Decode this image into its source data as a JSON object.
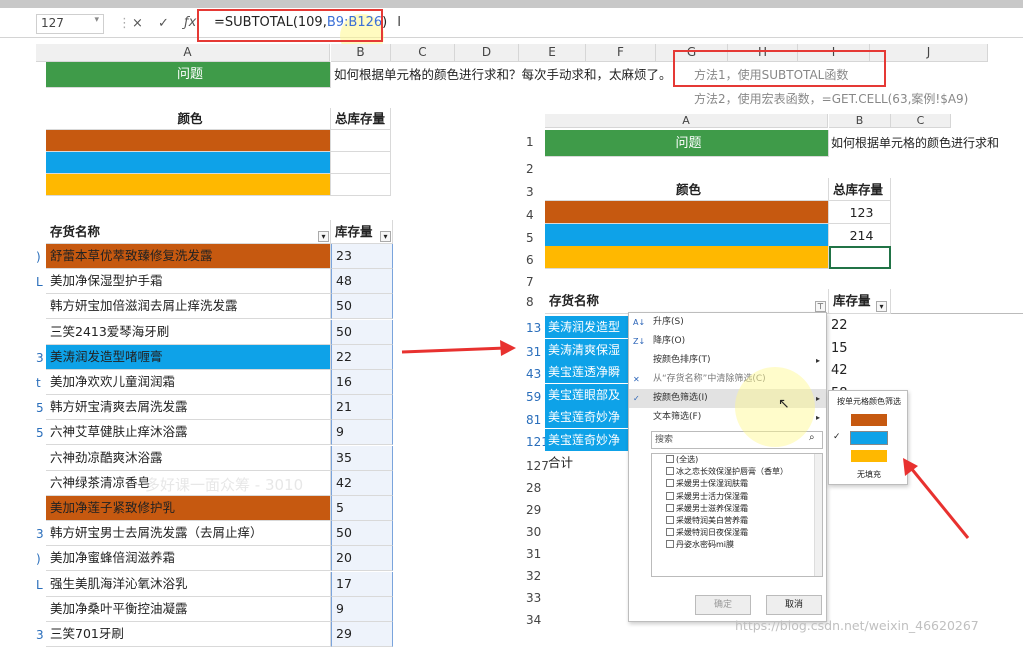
{
  "formula_bar": {
    "name_box": "127",
    "cancel": "×",
    "confirm": "✓",
    "fx": "ƒx",
    "formula_prefix": "=SUBTOTAL(109,",
    "formula_range": "B9:B126",
    "formula_suffix": ")"
  },
  "left_sheet": {
    "columns": [
      "A",
      "B",
      "C",
      "D",
      "E",
      "F",
      "G",
      "H",
      "I",
      "J"
    ],
    "question_label": "问题",
    "question_text": "如何根据单元格的颜色进行求和？每次手动求和，太麻烦了。",
    "method1": "方法1，使用SUBTOTAL函数",
    "method2": "方法2，使用宏表函数，=GET.CELL(63,案例!$A9)",
    "color_header": "颜色",
    "total_header": "总库存量",
    "name_header": "存货名称",
    "qty_header": "库存量",
    "row_numbers": [
      "",
      "",
      "",
      "",
      "",
      "",
      "",
      "",
      ")",
      "L",
      "",
      "",
      "3",
      "t",
      "5",
      "5",
      "",
      "",
      "",
      "3",
      ")",
      "L",
      "",
      "3",
      ""
    ],
    "items": [
      {
        "name": "舒蕾本草优萃致臻修复洗发露",
        "qty": "23",
        "color": "orange"
      },
      {
        "name": "美加净保湿型护手霜",
        "qty": "48",
        "color": ""
      },
      {
        "name": "韩方妍宝加倍滋润去屑止痒洗发露",
        "qty": "50",
        "color": ""
      },
      {
        "name": "三笑2413爱琴海牙刷",
        "qty": "50",
        "color": ""
      },
      {
        "name": "美涛润发造型啫喱膏",
        "qty": "22",
        "color": "blue"
      },
      {
        "name": "美加净欢欢儿童润润霜",
        "qty": "16",
        "color": ""
      },
      {
        "name": "韩方妍宝清爽去屑洗发露",
        "qty": "21",
        "color": ""
      },
      {
        "name": "六神艾草健肤止痒沐浴露",
        "qty": "9",
        "color": ""
      },
      {
        "name": "六神劲凉酷爽沐浴露",
        "qty": "35",
        "color": ""
      },
      {
        "name": "六神绿茶清凉香皂",
        "qty": "42",
        "color": ""
      },
      {
        "name": "美加净莲子紧致修护乳",
        "qty": "5",
        "color": "orange"
      },
      {
        "name": "韩方妍宝男士去屑洗发露（去屑止痒）",
        "qty": "50",
        "color": ""
      },
      {
        "name": "美加净蜜蜂倍润滋养霜",
        "qty": "20",
        "color": ""
      },
      {
        "name": "强生美肌海洋沁氧沐浴乳",
        "qty": "17",
        "color": ""
      },
      {
        "name": "美加净桑叶平衡控油凝露",
        "qty": "9",
        "color": ""
      },
      {
        "name": "三笑701牙刷",
        "qty": "29",
        "color": ""
      }
    ],
    "watermark": "一多好课一面众筹 - 3010"
  },
  "right_sheet": {
    "columns": [
      "A",
      "B",
      "C"
    ],
    "row_numbers": [
      "1",
      "2",
      "3",
      "4",
      "5",
      "6",
      "7",
      "8",
      "13",
      "31",
      "43",
      "59",
      "81",
      "121",
      "127",
      "28",
      "29",
      "30",
      "31",
      "32",
      "33",
      "34"
    ],
    "question_label": "问题",
    "question_text": "如何根据单元格的颜色进行求和",
    "color_header": "颜色",
    "total_header": "总库存量",
    "totals": [
      "123",
      "214",
      ""
    ],
    "name_header": "存货名称",
    "qty_header": "库存量",
    "items": [
      "美涛润发造型",
      "美涛清爽保湿",
      "美宝莲透净瞬",
      "美宝莲眼部及",
      "美宝莲奇妙净",
      "美宝莲奇妙净"
    ],
    "qtys": [
      "22",
      "15",
      "42",
      "58"
    ],
    "sum_label": "合计"
  },
  "filter_menu": {
    "sort_asc": "升序(S)",
    "sort_desc": "降序(O)",
    "sort_by_color": "按颜色排序(T)",
    "clear_filter": "从“存货名称”中清除筛选(C)",
    "filter_by_color": "按颜色筛选(I)",
    "text_filter": "文本筛选(F)",
    "search_placeholder": "搜索",
    "list": [
      "(全选)",
      "冰之恋长效保湿护唇膏（香草）",
      "采媛男士保湿润肤霜",
      "采媛男士活力保湿霜",
      "采媛男士滋养保湿霜",
      "采媛特润美白营养霜",
      "采媛特润日夜保湿霜",
      "丹姿水密码mi膜"
    ],
    "ok": "确定",
    "cancel": "取消"
  },
  "color_submenu": {
    "title": "按单元格颜色筛选",
    "swatches": [
      "#c65910",
      "#0ea2e8",
      "#ffb800"
    ],
    "no_fill": "无填充"
  },
  "watermark_url": "https://blog.csdn.net/weixin_46620267"
}
